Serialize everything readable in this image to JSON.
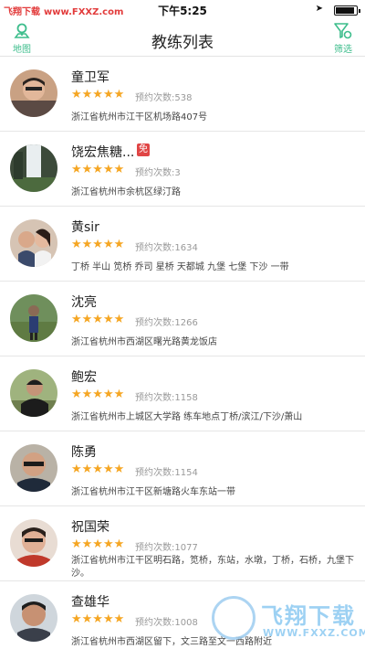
{
  "status_bar": {
    "watermark_brand": "飞翔下载",
    "watermark_url": "www.FXXZ.com",
    "time": "下午5:25",
    "location_icon": "location-arrow-icon",
    "battery_level": 0.85
  },
  "nav": {
    "title": "教练列表",
    "map_label": "地图",
    "map_icon": "map-pin-icon",
    "filter_label": "筛选",
    "filter_icon": "filter-icon",
    "accent_color": "#3dbd8c"
  },
  "coaches": [
    {
      "name": "童卫军",
      "rating": 5,
      "count_text": "预约次数:538",
      "address": "浙江省杭州市江干区机场路407号",
      "free": false
    },
    {
      "name": "饶宏焦糖...",
      "rating": 5,
      "count_text": "预约次数:3",
      "address": "浙江省杭州市余杭区绿汀路",
      "free": true,
      "free_label": "免"
    },
    {
      "name": "黄sir",
      "rating": 5,
      "count_text": "预约次数:1634",
      "address": "丁桥 半山 笕桥 乔司  星桥 天都城  九堡 七堡 下沙 一带",
      "free": false
    },
    {
      "name": "沈亮",
      "rating": 5,
      "count_text": "预约次数:1266",
      "address": "浙江省杭州市西湖区曙光路黄龙饭店",
      "free": false
    },
    {
      "name": "鲍宏",
      "rating": 5,
      "count_text": "预约次数:1158",
      "address": "浙江省杭州市上城区大学路 练车地点丁桥/滨江/下沙/萧山",
      "free": false
    },
    {
      "name": "陈勇",
      "rating": 5,
      "count_text": "预约次数:1154",
      "address": "浙江省杭州市江干区新塘路火车东站一带",
      "free": false
    },
    {
      "name": "祝国荣",
      "rating": 5,
      "count_text": "预约次数:1077",
      "address": "浙江省杭州市江干区明石路，笕桥，东站，水墩，丁桥，石桥，九堡下沙。",
      "free": false
    },
    {
      "name": "查雄华",
      "rating": 5,
      "count_text": "预约次数:1008",
      "address": "浙江省杭州市西湖区留下，文三路至文一西路附近",
      "free": false
    }
  ],
  "star_glyph": "★★★★★",
  "star_color": "#f5a623",
  "watermark_logo": {
    "big": "飞翔下载",
    "small": "WWW.FXXZ.COM"
  }
}
